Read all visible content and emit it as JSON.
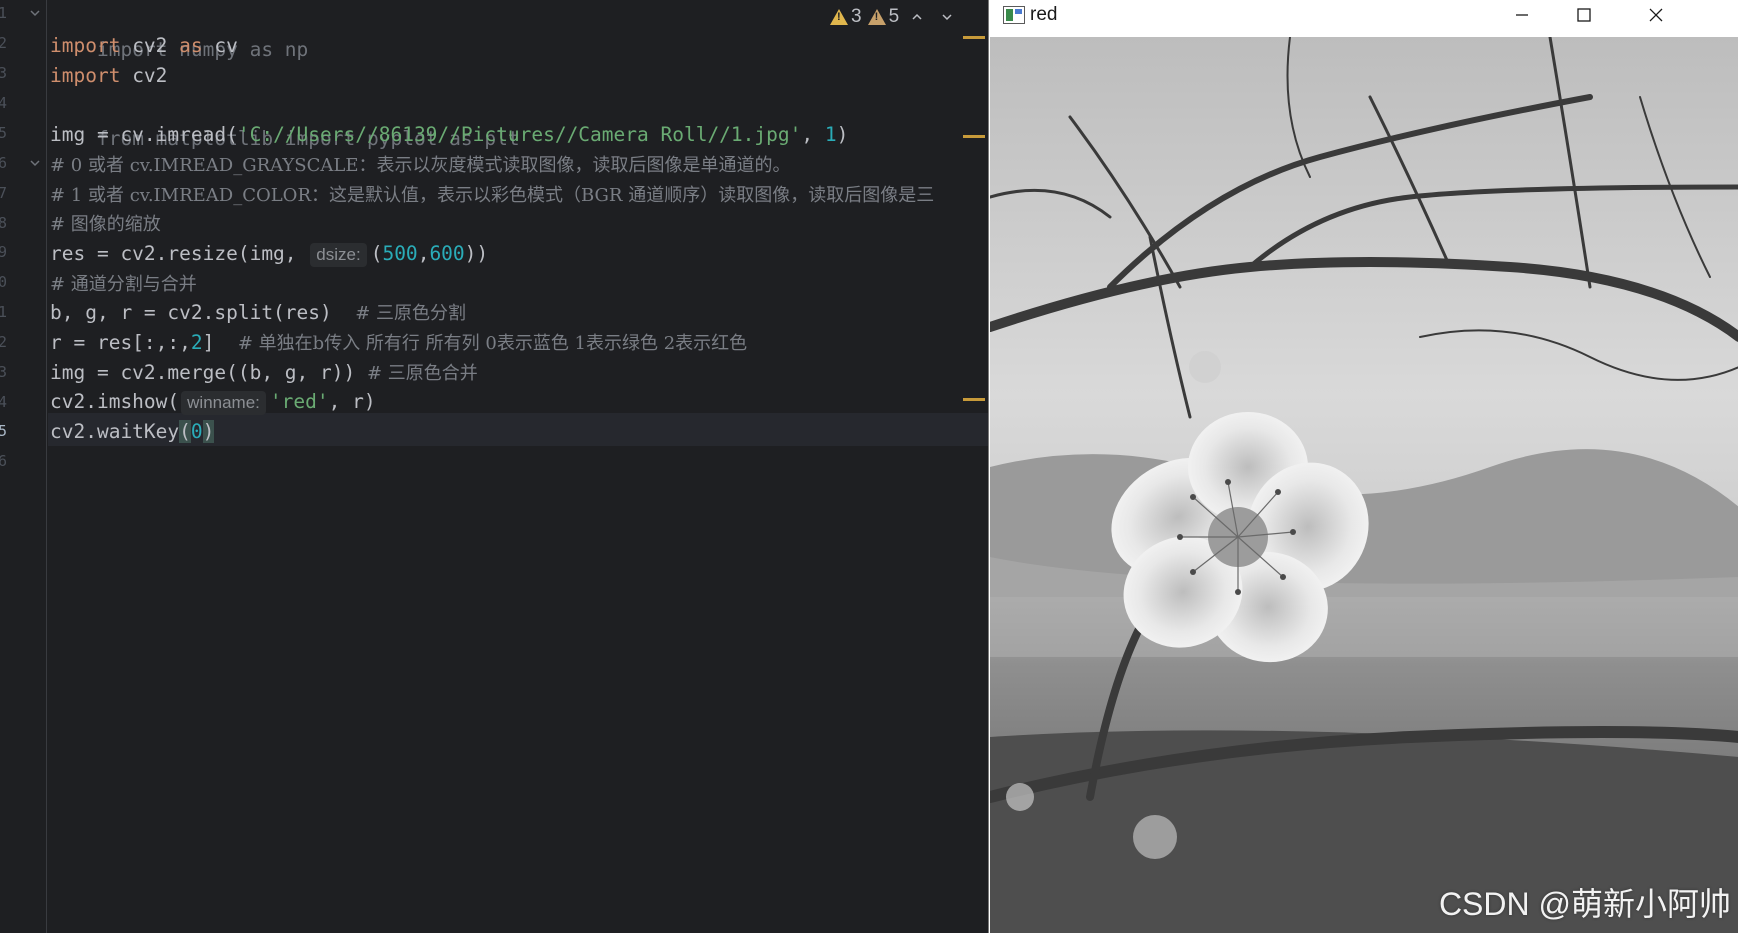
{
  "editor": {
    "line_numbers": [
      "1",
      "2",
      "3",
      "4",
      "5",
      "6",
      "7",
      "8",
      "9",
      "0",
      "1",
      "2",
      "3",
      "4",
      "5",
      "6"
    ],
    "inspections": {
      "warnings_count": "3",
      "weak_warnings_count": "5"
    },
    "lines": [
      {
        "t1": "import numpy as np"
      },
      {
        "k1": "import",
        "t1": " cv2 ",
        "k2": "as",
        "t2": " cv"
      },
      {
        "k1": "import",
        "t1": " cv2"
      },
      {
        "t1": "from matplotlib import pyplot as plt"
      },
      {
        "t1": "img = cv.imread(",
        "s1": "'C://Users//86139//Pictures//Camera Roll//1.jpg'",
        "t2": ", ",
        "n1": "1",
        "t3": ")"
      },
      {
        "c1": "# 0 或者 cv.IMREAD_GRAYSCALE：表示以灰度模式读取图像，读取后图像是单通道的。"
      },
      {
        "c1": "# 1 或者 cv.IMREAD_COLOR：这是默认值，表示以彩色模式（BGR 通道顺序）读取图像，读取后图像是三"
      },
      {
        "c1": "# 图像的缩放"
      },
      {
        "t1": "res = cv2.resize(img, ",
        "hint": "dsize:",
        "t2": "(",
        "n1": "500",
        "t3": ",",
        "n2": "600",
        "t4": "))"
      },
      {
        "c1": "# 通道分割与合并"
      },
      {
        "t1": "b, g, r = cv2.split(res)  ",
        "c1": "# 三原色分割"
      },
      {
        "t1": "r = res[:,:,",
        "n1": "2",
        "t2": "]  ",
        "c1": "# 单独在b传入 所有行 所有列 0表示蓝色 1表示绿色 2表示红色"
      },
      {
        "t1": "img = cv2.merge((b, g, r)) ",
        "c1": "# 三原色合并"
      },
      {
        "t1": "cv2.imshow(",
        "hint": "winname:",
        "s1": "'red'",
        "t2": ", r)"
      },
      {
        "t1": "cv2.waitKey",
        "b1": "(",
        "n1": "0",
        "b2": ")"
      }
    ]
  },
  "image_window": {
    "title": "red",
    "watermark": "CSDN @萌新小阿帅",
    "photo_subject": "grayscale-plum-blossom"
  },
  "colors": {
    "editor_bg": "#1e1f22",
    "keyword": "#cf8e6d",
    "string": "#6aab73",
    "number": "#2aacb8",
    "comment": "#7a7e85",
    "warning": "#e0b64d"
  }
}
